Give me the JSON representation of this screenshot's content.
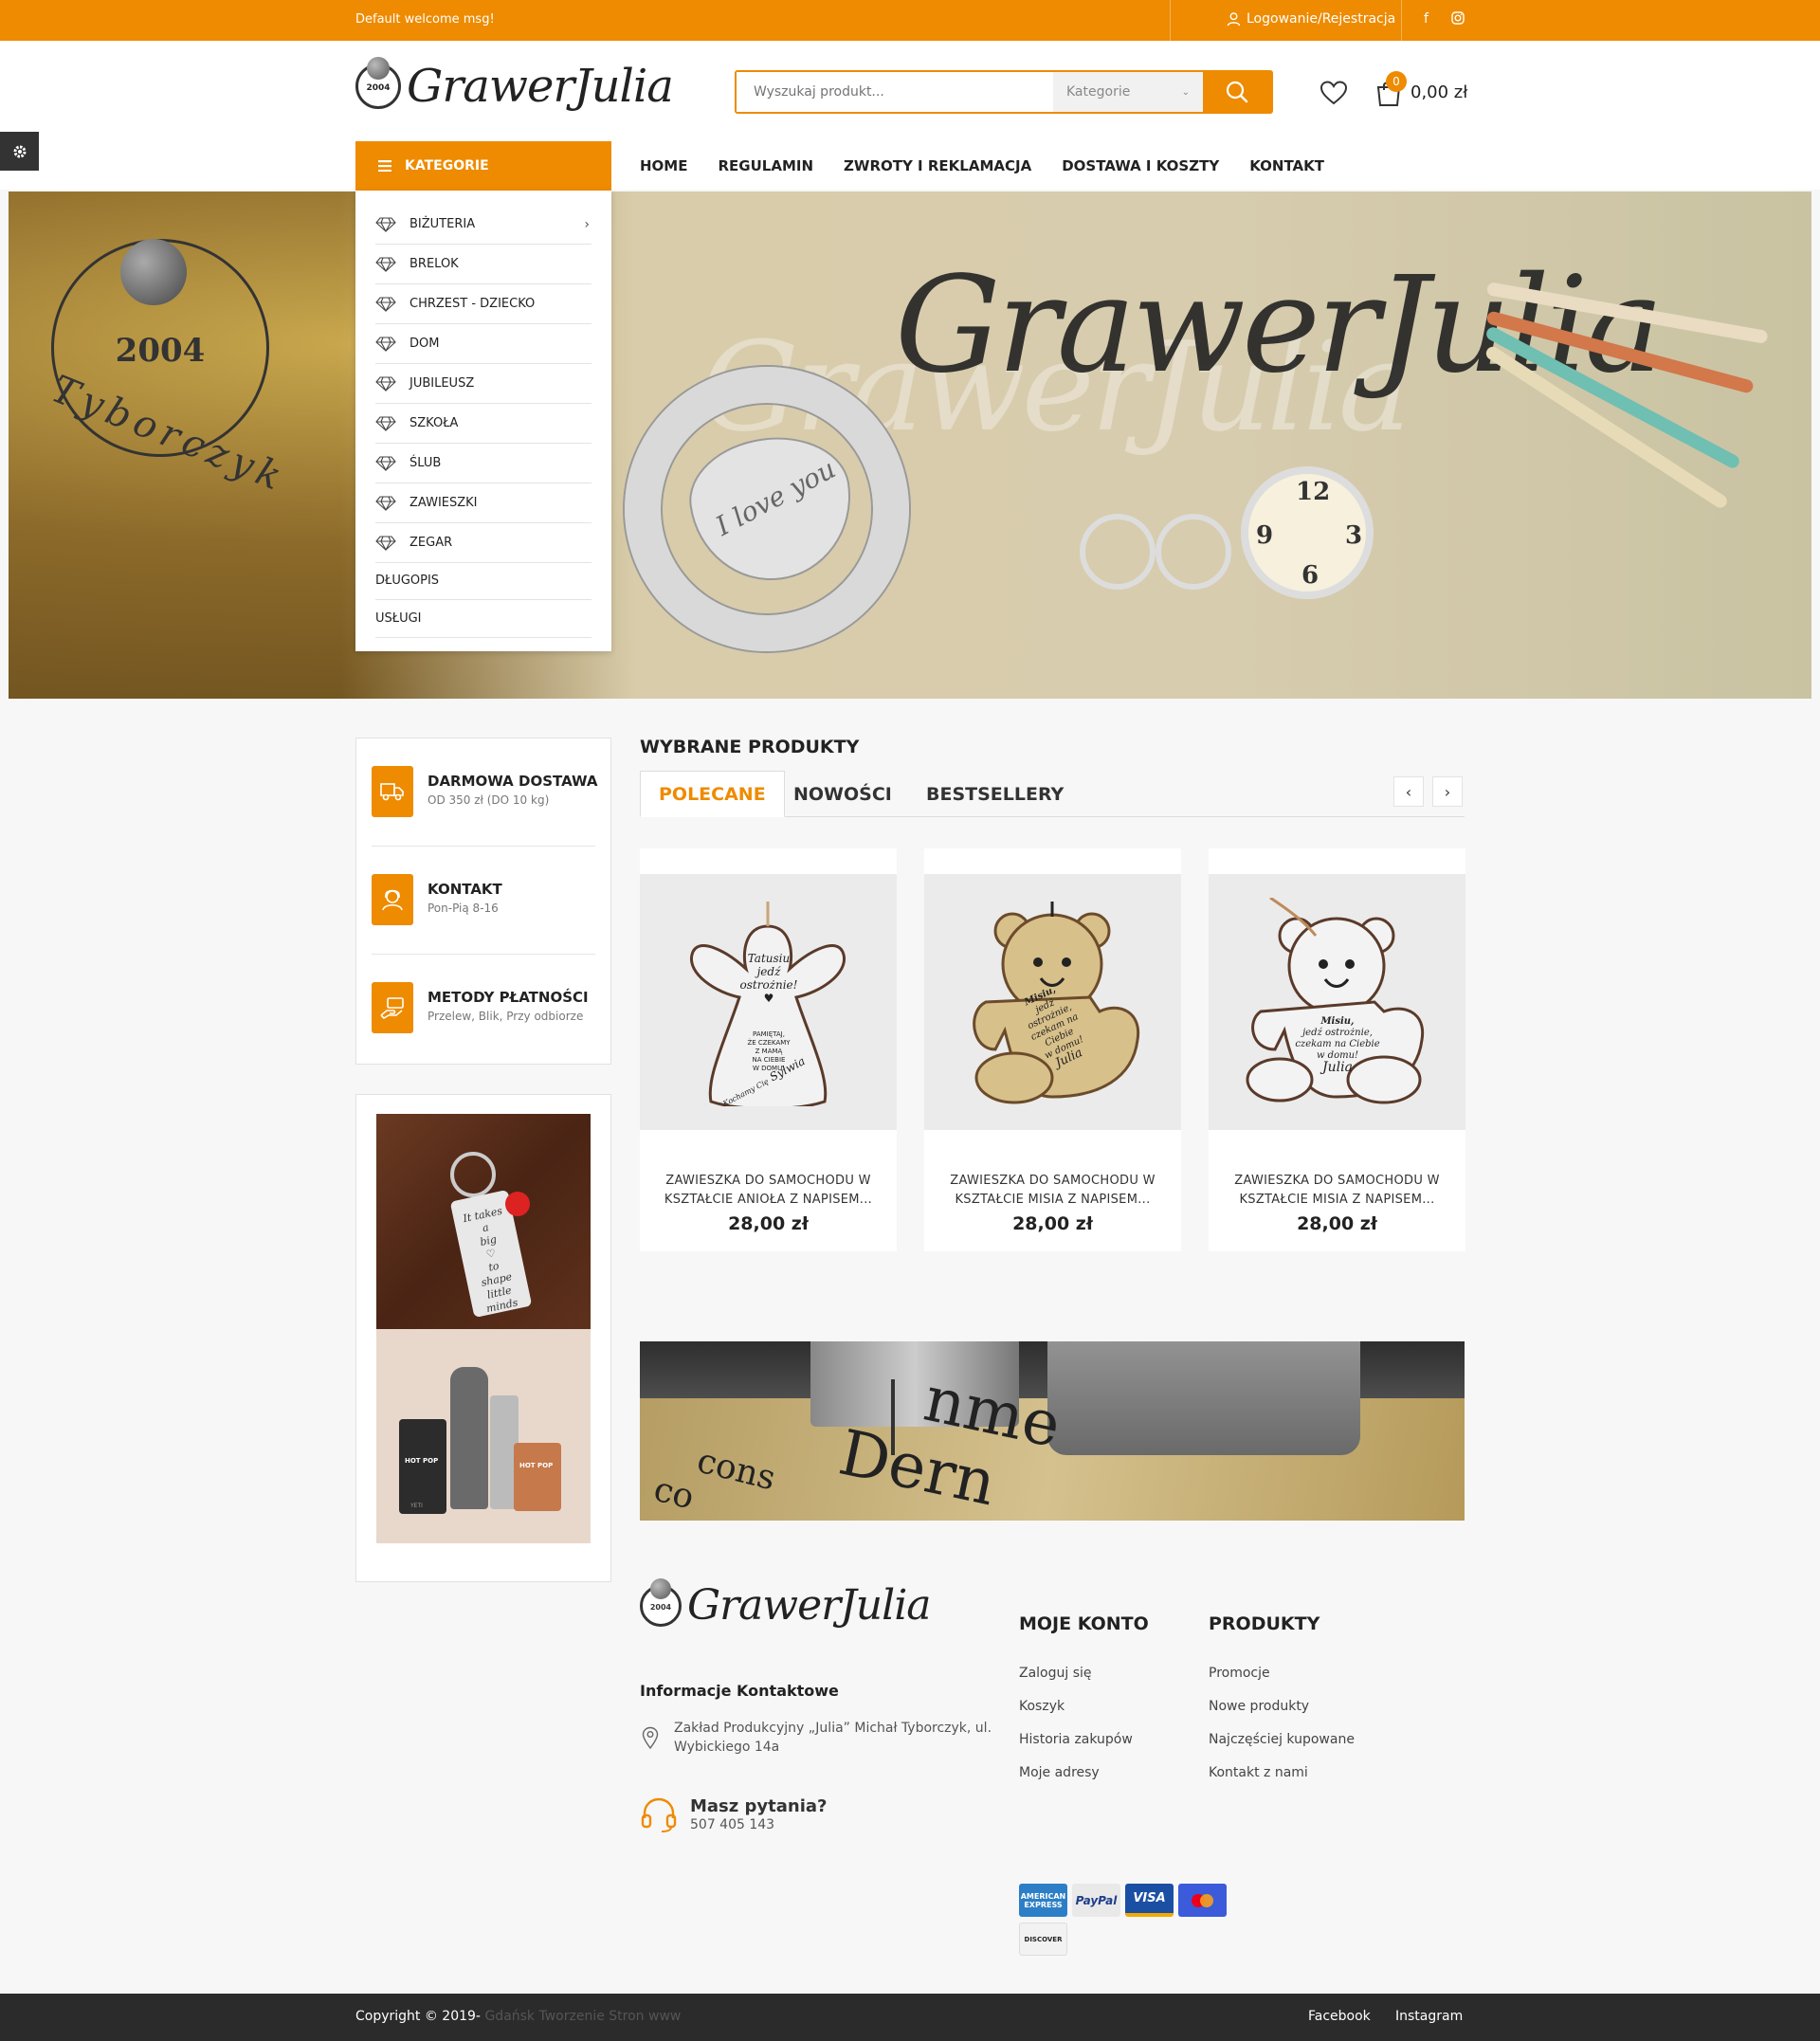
{
  "topbar": {
    "welcome": "Default welcome msg!",
    "login": "Logowanie/Rejestracja",
    "social": [
      "facebook-icon",
      "instagram-icon"
    ],
    "accent": "#ee8b00"
  },
  "header": {
    "logo_year": "2004",
    "logo_text": "GrawerJulia",
    "search_placeholder": "Wyszukaj produkt...",
    "search_category": "Kategorie",
    "cart_count": "0",
    "cart_total": "0,00 zł"
  },
  "nav": {
    "categories_label": "KATEGORIE",
    "items": [
      "HOME",
      "REGULAMIN",
      "ZWROTY I REKLAMACJA",
      "DOSTAWA I KOSZTY",
      "KONTAKT"
    ]
  },
  "categories": [
    {
      "label": "BIŻUTERIA",
      "icon": "diamond-icon",
      "has_sub": true
    },
    {
      "label": "BRELOK",
      "icon": "diamond-icon"
    },
    {
      "label": "CHRZEST - DZIECKO",
      "icon": "diamond-icon"
    },
    {
      "label": "DOM",
      "icon": "diamond-icon"
    },
    {
      "label": "JUBILEUSZ",
      "icon": "diamond-icon"
    },
    {
      "label": "SZKOŁA",
      "icon": "diamond-icon"
    },
    {
      "label": "ŚLUB",
      "icon": "diamond-icon"
    },
    {
      "label": "ZAWIESZKI",
      "icon": "diamond-icon"
    },
    {
      "label": "ZEGAR",
      "icon": "diamond-icon"
    },
    {
      "label": "DŁUGOPIS"
    },
    {
      "label": "USŁUGI"
    }
  ],
  "hero": {
    "brand_text": "GrawerJulia",
    "year": "2004",
    "family": "Tyborczyk",
    "heart_text": "I love you",
    "clock_numbers": [
      "12",
      "3",
      "6",
      "9"
    ]
  },
  "services": [
    {
      "title": "DARMOWA DOSTAWA",
      "subtitle": "OD 350 zł (DO 10 kg)",
      "icon": "truck-icon"
    },
    {
      "title": "KONTAKT",
      "subtitle": "Pon-Pią 8-16",
      "icon": "support-icon"
    },
    {
      "title": "METODY PŁATNOŚCI",
      "subtitle": "Przelew, Blik, Przy odbiorze",
      "icon": "payment-hand-icon"
    }
  ],
  "products_section": {
    "title": "WYBRANE PRODUKTY",
    "tabs": [
      "POLECANE",
      "NOWOŚCI",
      "BESTSELLERY"
    ],
    "active_tab": "POLECANE",
    "products": [
      {
        "name": "ZAWIESZKA DO SAMOCHODU W KSZTAŁCIE ANIOŁA Z NAPISEM...",
        "price": "28,00 zł",
        "image": "angel-pendant",
        "engraving": [
          "Tatusiu",
          "jedź",
          "ostrożnie!",
          "PAMIĘTAJ,",
          "ŻE CZEKAMY",
          "Z MAMĄ",
          "NA CIEBIE",
          "W DOMU!",
          "Kochamy Cię",
          "Sylwia"
        ]
      },
      {
        "name": "ZAWIESZKA DO SAMOCHODU W KSZTAŁCIE MISIA Z NAPISEM...",
        "price": "28,00 zł",
        "image": "bear-pendant-gold",
        "engraving": [
          "Misiu,",
          "jedź ostrożnie,",
          "czekam na Ciebie",
          "w domu!",
          "Julia"
        ]
      },
      {
        "name": "ZAWIESZKA DO SAMOCHODU W KSZTAŁCIE MISIA Z NAPISEM...",
        "price": "28,00 zł",
        "image": "bear-pendant-silver",
        "engraving": [
          "Misiu,",
          "jedź ostrożnie,",
          "czekam na Ciebie",
          "w domu!",
          "Julia"
        ]
      }
    ]
  },
  "sidebar_images": {
    "keychain_text": [
      "It",
      "takes a",
      "big",
      "to",
      "shape",
      "little",
      "minds"
    ],
    "cup_labels": [
      "HOT POP",
      "HOT POP",
      "YETI"
    ]
  },
  "engrave_banner": {
    "words": [
      "Dern",
      "nme",
      "cons",
      "co"
    ]
  },
  "footer": {
    "logo_year": "2004",
    "logo_text": "GrawerJulia",
    "info_title": "Informacje Kontaktowe",
    "address": "Zakład Produkcyjny „Julia” Michał Tyborczyk, ul. Wybickiego 14a",
    "question": "Masz pytania?",
    "phone": "507 405 143",
    "account_title": "MOJE KONTO",
    "account_links": [
      "Zaloguj się",
      "Koszyk",
      "Historia zakupów",
      "Moje adresy"
    ],
    "products_title": "PRODUKTY",
    "products_links": [
      "Promocje",
      "Nowe produkty",
      "Najczęściej kupowane",
      "Kontakt z nami"
    ],
    "payments": [
      "AMERICAN EXPRESS",
      "PayPal",
      "VISA",
      "mastercard",
      "DISCOVER"
    ],
    "copyright": "Copyright © 2019-",
    "copyright_dim": "Gdańsk Tworzenie Stron www",
    "bottom_links": [
      "Facebook",
      "Instagram"
    ]
  }
}
